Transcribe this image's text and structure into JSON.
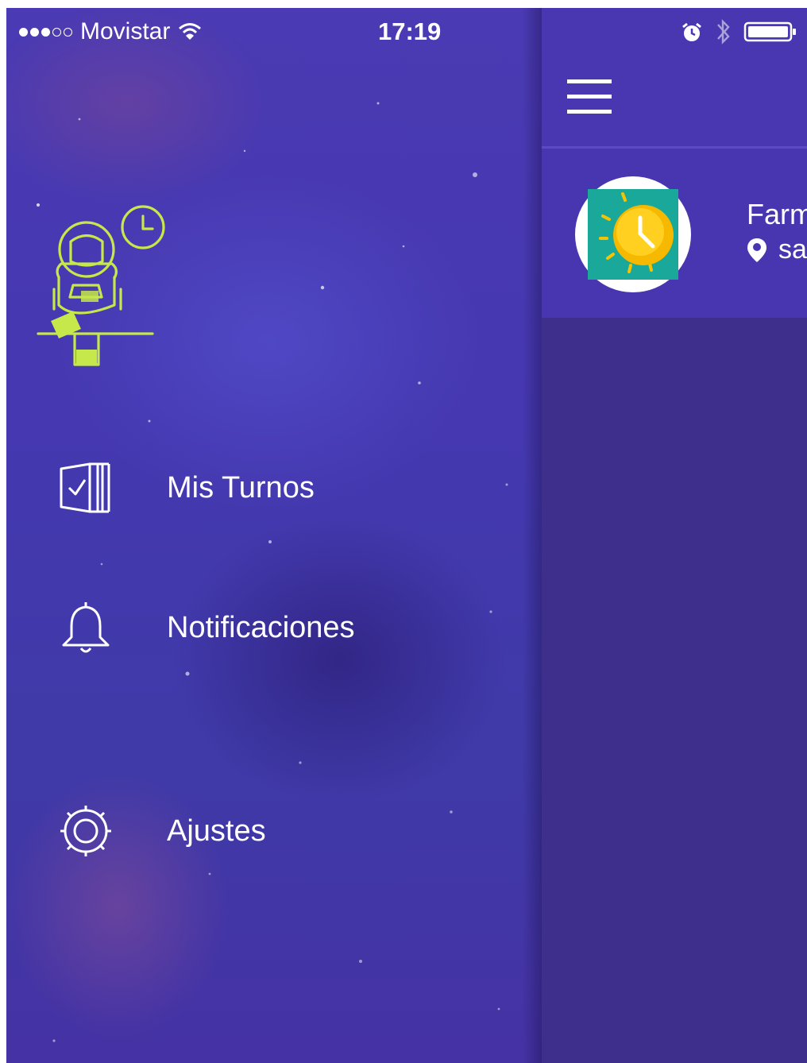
{
  "status_bar": {
    "carrier": "Movistar",
    "time": "17:19",
    "signal_bars_filled": 3,
    "signal_bars_total": 5
  },
  "drawer": {
    "illustration_icon": "astronaut-clock-illustration",
    "menu": [
      {
        "label": "Mis Turnos",
        "icon": "ticket-check-icon"
      },
      {
        "label": "Notificaciones",
        "icon": "bell-icon"
      },
      {
        "label": "Ajustes",
        "icon": "gear-icon"
      }
    ]
  },
  "main": {
    "menu_icon": "hamburger-menu-icon",
    "card": {
      "title": "Farm",
      "location": "sa",
      "avatar_icon": "sun-clock-icon"
    }
  },
  "colors": {
    "drawer_bg": "#4539ad",
    "topbar_bg": "#4937b2",
    "main_bg": "#3d2f8b",
    "accent_lime": "#c6e84a",
    "avatar_teal": "#1aa89a",
    "avatar_sun": "#f5b800"
  }
}
